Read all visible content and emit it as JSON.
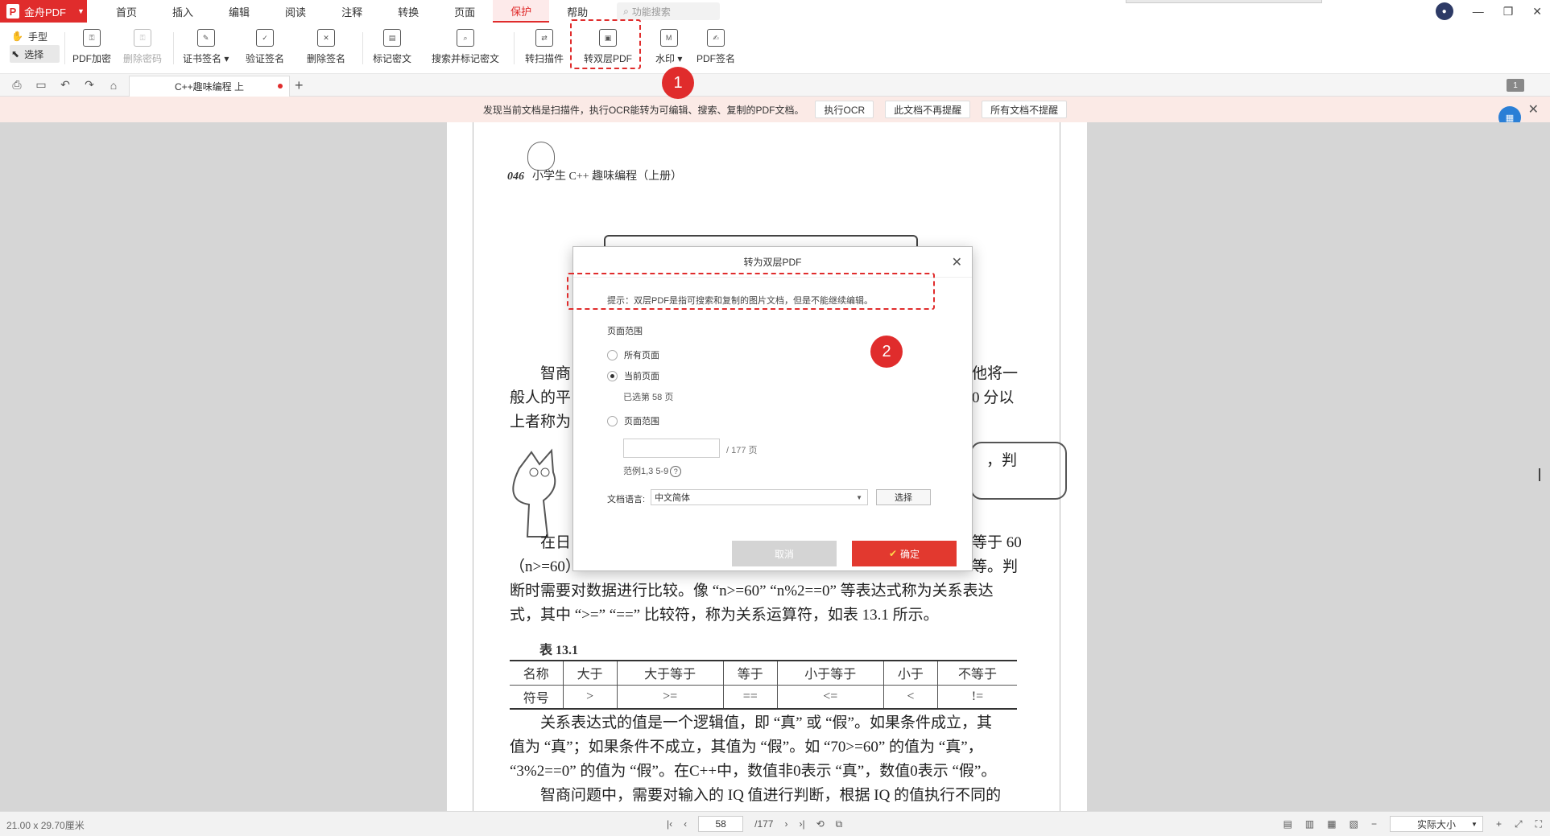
{
  "app": {
    "brand": "金舟PDF",
    "search_placeholder": "功能搜索"
  },
  "menu": [
    "首页",
    "插入",
    "编辑",
    "阅读",
    "注释",
    "转换",
    "页面",
    "保护",
    "帮助"
  ],
  "menu_active": "保护",
  "toolbar": {
    "hand": "手型",
    "select": "选择",
    "items": [
      {
        "label": "PDF加密"
      },
      {
        "label": "删除密码"
      },
      {
        "label": "证书签名 ▾"
      },
      {
        "label": "验证签名"
      },
      {
        "label": "删除签名"
      },
      {
        "label": "标记密文"
      },
      {
        "label": "搜索并标记密文"
      },
      {
        "label": "转扫描件"
      },
      {
        "label": "转双层PDF"
      },
      {
        "label": "水印 ▾"
      },
      {
        "label": "PDF签名"
      }
    ]
  },
  "tabs": {
    "doc_tab": "C++趣味编程 上",
    "page_badge": "1"
  },
  "ocr_bar": {
    "message": "发现当前文档是扫描件，执行OCR能转为可编辑、搜索、复制的PDF文档。",
    "run": "执行OCR",
    "dont_remind_doc": "此文档不再提醒",
    "dont_remind_all": "所有文档不提醒"
  },
  "page": {
    "header_num": "046",
    "header_title": "小学生 C++ 趣味编程（上册）",
    "lines": [
      "智商",
      "他将一",
      "般人的平",
      "0 分以",
      "上者称为",
      "，判",
      "在日",
      "等于 60",
      "（n>=60）",
      "等。判",
      "断时需要对数据进行比较。像 “n>=60” “n%2==0” 等表达式称为关系表达",
      "式，其中 “>=” “==” 比较符，称为关系运算符，如表 13.1 所示。",
      "关系表达式的值是一个逻辑值，即 “真” 或 “假”。如果条件成立，其",
      "值为 “真”；如果条件不成立，其值为 “假”。如 “70>=60” 的值为 “真”，",
      "“3%2==0” 的值为 “假”。在C++中，数值非0表示 “真”，数值0表示 “假”。",
      "智商问题中，需要对输入的 IQ 值进行判断，根据 IQ 的值执行不同的"
    ],
    "table_title": "表 13.1",
    "table_header": [
      "名称",
      "大于",
      "大于等于",
      "等于",
      "小于等于",
      "小于",
      "不等于"
    ],
    "table_row": [
      "符号",
      ">",
      ">=",
      "==",
      "<=",
      "<",
      "!="
    ]
  },
  "dialog": {
    "title": "转为双层PDF",
    "hint": "提示：双层PDF是指可搜索和复制的图片文档，但是不能继续编辑。",
    "section": "页面范围",
    "all_pages": "所有页面",
    "current_page": "当前页面",
    "selected_note": "已选第 58 页",
    "page_range": "页面范围",
    "range_total": "/ 177 页",
    "range_example": "范例1,3 5-9",
    "lang_label": "文档语言:",
    "lang_value": "中文简体",
    "choose": "选择",
    "cancel": "取消",
    "ok": "确定"
  },
  "annotations": {
    "badge1": "1",
    "badge2": "2"
  },
  "status": {
    "size": "21.00 x 29.70厘米",
    "current_page": "58",
    "total_pages": "/177",
    "zoom": "实际大小"
  },
  "colors": {
    "accent": "#e02c2c",
    "ok_button": "#e2392f",
    "ocr_bar": "#fbeae6"
  }
}
